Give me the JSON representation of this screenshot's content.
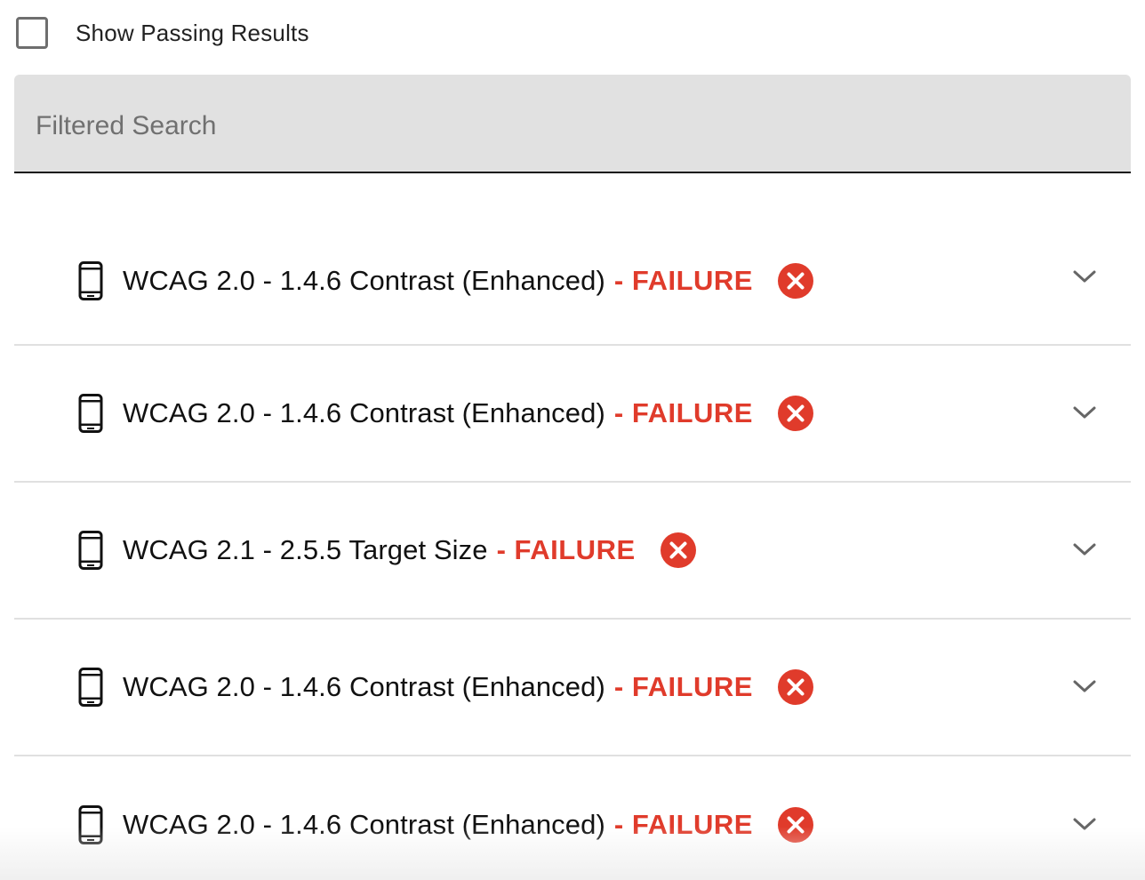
{
  "filter": {
    "show_passing_label": "Show Passing Results",
    "show_passing_checked": false
  },
  "search": {
    "placeholder": "Filtered Search",
    "value": ""
  },
  "results": [
    {
      "title": "WCAG 2.0 - 1.4.6 Contrast (Enhanced)",
      "status": "- FAILURE",
      "icon": "mobile-phone-icon",
      "status_icon": "error-x-icon"
    },
    {
      "title": "WCAG 2.0 - 1.4.6 Contrast (Enhanced)",
      "status": "- FAILURE",
      "icon": "mobile-phone-icon",
      "status_icon": "error-x-icon"
    },
    {
      "title": "WCAG 2.1 - 2.5.5 Target Size",
      "status": "- FAILURE",
      "icon": "mobile-phone-icon",
      "status_icon": "error-x-icon"
    },
    {
      "title": "WCAG 2.0 - 1.4.6 Contrast (Enhanced)",
      "status": "- FAILURE",
      "icon": "mobile-phone-icon",
      "status_icon": "error-x-icon"
    },
    {
      "title": "WCAG 2.0 - 1.4.6 Contrast (Enhanced)",
      "status": "- FAILURE",
      "icon": "mobile-phone-icon",
      "status_icon": "error-x-icon"
    }
  ],
  "colors": {
    "failure": "#e03b2b",
    "search_background": "#e1e1e1"
  }
}
